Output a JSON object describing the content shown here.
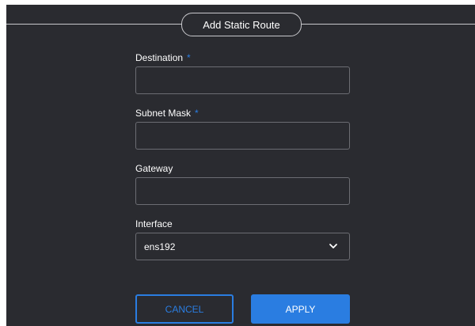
{
  "dialog": {
    "title": "Add Static Route"
  },
  "fields": {
    "destination": {
      "label": "Destination",
      "required_marker": "*",
      "value": ""
    },
    "subnet_mask": {
      "label": "Subnet Mask",
      "required_marker": "*",
      "value": ""
    },
    "gateway": {
      "label": "Gateway",
      "value": ""
    },
    "interface": {
      "label": "Interface",
      "selected": "ens192"
    }
  },
  "buttons": {
    "cancel": "CANCEL",
    "apply": "APPLY"
  },
  "colors": {
    "background": "#2a2b30",
    "accent": "#2a7de1",
    "border": "#6c6d73",
    "text": "#ffffff"
  },
  "icons": {
    "interface_dropdown": "chevron-down-icon"
  }
}
